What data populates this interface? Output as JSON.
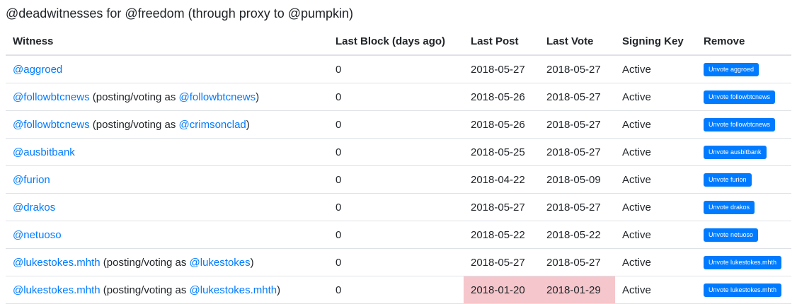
{
  "title": "@deadwitnesses for @freedom (through proxy to @pumpkin)",
  "columns": {
    "witness": "Witness",
    "last_block": "Last Block (days ago)",
    "last_post": "Last Post",
    "last_vote": "Last Vote",
    "signing_key": "Signing Key",
    "remove": "Remove"
  },
  "status_colors": {
    "warning": "#ffeeba",
    "danger": "#f5c6cb",
    "link": "#007bff"
  },
  "rows": [
    {
      "witness": "@aggroed",
      "proxy_prefix": "",
      "proxy": "",
      "proxy_suffix": "",
      "last_block": "0",
      "last_post": "2018-05-27",
      "last_vote": "2018-05-27",
      "signing_key": "Active",
      "button": "Unvote aggroed",
      "post_status": "",
      "vote_status": ""
    },
    {
      "witness": "@followbtcnews",
      "proxy_prefix": " (posting/voting as ",
      "proxy": "@followbtcnews",
      "proxy_suffix": ")",
      "last_block": "0",
      "last_post": "2018-05-26",
      "last_vote": "2018-05-27",
      "signing_key": "Active",
      "button": "Unvote followbtcnews",
      "post_status": "",
      "vote_status": ""
    },
    {
      "witness": "@followbtcnews",
      "proxy_prefix": " (posting/voting as ",
      "proxy": "@crimsonclad",
      "proxy_suffix": ")",
      "last_block": "0",
      "last_post": "2018-05-26",
      "last_vote": "2018-05-27",
      "signing_key": "Active",
      "button": "Unvote followbtcnews",
      "post_status": "",
      "vote_status": ""
    },
    {
      "witness": "@ausbitbank",
      "proxy_prefix": "",
      "proxy": "",
      "proxy_suffix": "",
      "last_block": "0",
      "last_post": "2018-05-25",
      "last_vote": "2018-05-27",
      "signing_key": "Active",
      "button": "Unvote ausbitbank",
      "post_status": "",
      "vote_status": ""
    },
    {
      "witness": "@furion",
      "proxy_prefix": "",
      "proxy": "",
      "proxy_suffix": "",
      "last_block": "0",
      "last_post": "2018-04-22",
      "last_vote": "2018-05-09",
      "signing_key": "Active",
      "button": "Unvote furion",
      "post_status": "warning",
      "vote_status": ""
    },
    {
      "witness": "@drakos",
      "proxy_prefix": "",
      "proxy": "",
      "proxy_suffix": "",
      "last_block": "0",
      "last_post": "2018-05-27",
      "last_vote": "2018-05-27",
      "signing_key": "Active",
      "button": "Unvote drakos",
      "post_status": "",
      "vote_status": ""
    },
    {
      "witness": "@netuoso",
      "proxy_prefix": "",
      "proxy": "",
      "proxy_suffix": "",
      "last_block": "0",
      "last_post": "2018-05-22",
      "last_vote": "2018-05-22",
      "signing_key": "Active",
      "button": "Unvote netuoso",
      "post_status": "",
      "vote_status": ""
    },
    {
      "witness": "@lukestokes.mhth",
      "proxy_prefix": " (posting/voting as ",
      "proxy": "@lukestokes",
      "proxy_suffix": ")",
      "last_block": "0",
      "last_post": "2018-05-27",
      "last_vote": "2018-05-27",
      "signing_key": "Active",
      "button": "Unvote lukestokes.mhth",
      "post_status": "",
      "vote_status": ""
    },
    {
      "witness": "@lukestokes.mhth",
      "proxy_prefix": " (posting/voting as ",
      "proxy": "@lukestokes.mhth",
      "proxy_suffix": ")",
      "last_block": "0",
      "last_post": "2018-01-20",
      "last_vote": "2018-01-29",
      "signing_key": "Active",
      "button": "Unvote lukestokes.mhth",
      "post_status": "danger",
      "vote_status": "danger"
    }
  ]
}
